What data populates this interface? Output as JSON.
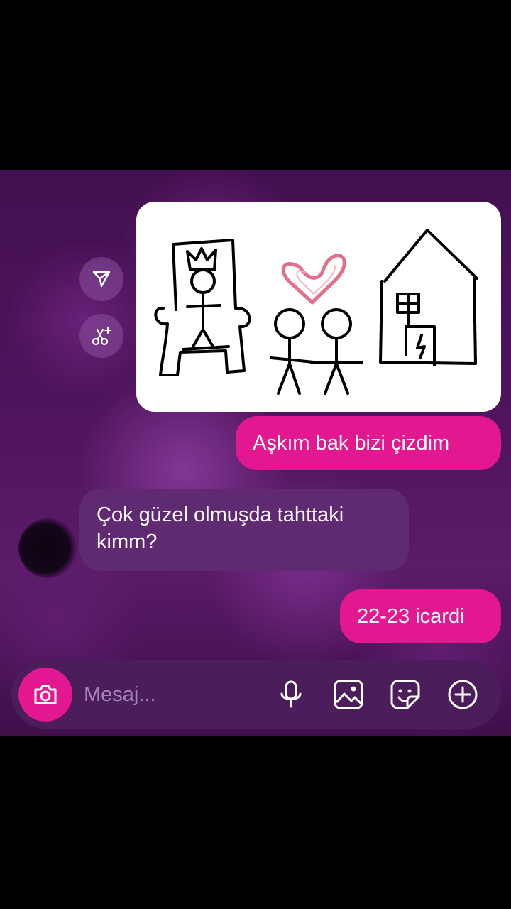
{
  "chat": {
    "messages": [
      {
        "direction": "outgoing",
        "type": "image",
        "image_description": "hand drawing"
      },
      {
        "direction": "outgoing",
        "type": "text",
        "text": "Aşkım bak bizi çizdim"
      },
      {
        "direction": "incoming",
        "type": "text",
        "text": "Çok güzel olmuşda tahttaki kimm?"
      },
      {
        "direction": "outgoing",
        "type": "text",
        "text": "22-23 icardi"
      }
    ],
    "image_actions": [
      "share-icon",
      "sparkle-scissors-icon"
    ]
  },
  "composer": {
    "placeholder": "Mesaj...",
    "value": "",
    "icons": [
      "camera-icon",
      "microphone-icon",
      "gallery-icon",
      "sticker-icon",
      "plus-circle-icon"
    ]
  },
  "colors": {
    "outgoing_bubble": "#e3178f",
    "incoming_bubble": "#5f2a72",
    "composer_bg": "#4b1e5b"
  }
}
